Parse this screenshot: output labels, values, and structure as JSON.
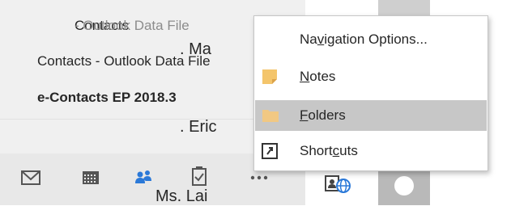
{
  "folders": [
    {
      "name": "Contacts",
      "suffix": " - Outlook Data File"
    },
    {
      "name": "Contacts - Outlook Data File"
    },
    {
      "name": "e-Contacts EP 2018.3"
    }
  ],
  "nav": {
    "icons": [
      "mail-icon",
      "calendar-icon",
      "people-icon",
      "tasks-icon",
      "more-icon"
    ],
    "active": "people-icon"
  },
  "contacts": [
    ". Ma",
    ". Eric",
    "Ms. Lai"
  ],
  "context_menu": {
    "items": [
      {
        "pre": "Na",
        "ul": "v",
        "post": "igation Options...",
        "icon": ""
      },
      {
        "pre": "",
        "ul": "N",
        "post": "otes",
        "icon": "notes-icon"
      },
      {
        "pre": "",
        "ul": "F",
        "post": "olders",
        "icon": "folder-icon"
      },
      {
        "pre": "Short",
        "ul": "c",
        "post": "uts",
        "icon": "shortcut-icon"
      }
    ],
    "highlighted_index": 2
  },
  "colors": {
    "accent": "#2b79d8",
    "highlight": "#c7c7c7",
    "notes": "#f4c56b",
    "folder": "#f1c883"
  }
}
